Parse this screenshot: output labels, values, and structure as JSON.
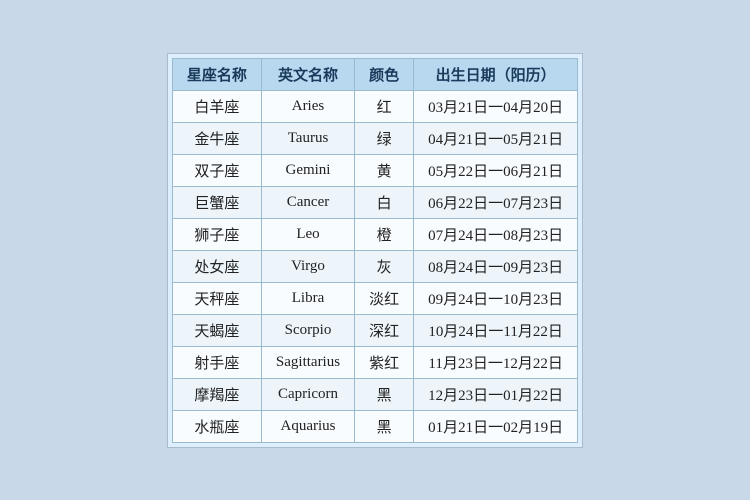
{
  "table": {
    "headers": [
      "星座名称",
      "英文名称",
      "颜色",
      "出生日期（阳历）"
    ],
    "rows": [
      [
        "白羊座",
        "Aries",
        "红",
        "03月21日一04月20日"
      ],
      [
        "金牛座",
        "Taurus",
        "绿",
        "04月21日一05月21日"
      ],
      [
        "双子座",
        "Gemini",
        "黄",
        "05月22日一06月21日"
      ],
      [
        "巨蟹座",
        "Cancer",
        "白",
        "06月22日一07月23日"
      ],
      [
        "狮子座",
        "Leo",
        "橙",
        "07月24日一08月23日"
      ],
      [
        "处女座",
        "Virgo",
        "灰",
        "08月24日一09月23日"
      ],
      [
        "天秤座",
        "Libra",
        "淡红",
        "09月24日一10月23日"
      ],
      [
        "天蝎座",
        "Scorpio",
        "深红",
        "10月24日一11月22日"
      ],
      [
        "射手座",
        "Sagittarius",
        "紫红",
        "11月23日一12月22日"
      ],
      [
        "摩羯座",
        "Capricorn",
        "黑",
        "12月23日一01月22日"
      ],
      [
        "水瓶座",
        "Aquarius",
        "黑",
        "01月21日一02月19日"
      ]
    ]
  }
}
